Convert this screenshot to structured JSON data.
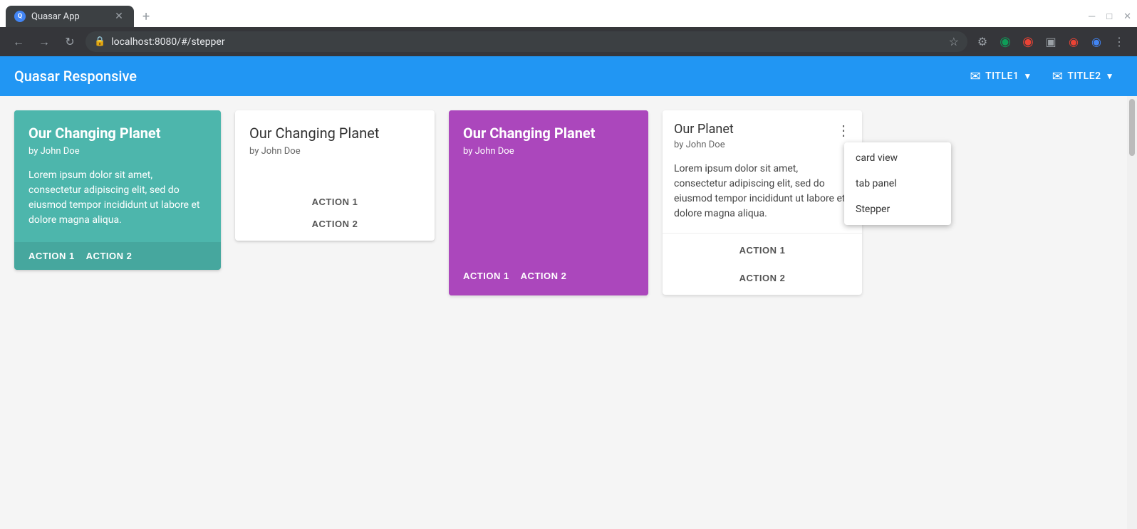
{
  "browser": {
    "tab_title": "Quasar App",
    "url": "localhost:8080/#/stepper",
    "new_tab_icon": "+",
    "back_disabled": false,
    "forward_disabled": true
  },
  "app": {
    "title": "Quasar Responsive",
    "nav_items": [
      {
        "id": "title1",
        "label": "TITLE1",
        "has_arrow": true,
        "icon": "✉"
      },
      {
        "id": "title2",
        "label": "TITLE2",
        "has_arrow": true,
        "icon": "✉"
      }
    ]
  },
  "dropdown": {
    "items": [
      {
        "id": "card-view",
        "label": "card view"
      },
      {
        "id": "tab-panel",
        "label": "tab panel"
      },
      {
        "id": "stepper",
        "label": "Stepper"
      }
    ]
  },
  "cards": [
    {
      "id": "card-green",
      "type": "green",
      "title": "Our Changing Planet",
      "subtitle": "by John Doe",
      "body": "Lorem ipsum dolor sit amet, consectetur adipiscing elit, sed do eiusmod tempor incididunt ut labore et dolore magna aliqua.",
      "actions": [
        "ACTION 1",
        "ACTION 2"
      ]
    },
    {
      "id": "card-white",
      "type": "white",
      "title": "Our Changing Planet",
      "subtitle": "by John Doe",
      "actions": [
        "ACTION 1",
        "ACTION 2"
      ]
    },
    {
      "id": "card-purple",
      "type": "purple",
      "title": "Our Changing Planet",
      "subtitle": "by John Doe",
      "actions": [
        "ACTION 1",
        "ACTION 2"
      ]
    },
    {
      "id": "card-detail",
      "type": "detail",
      "title": "Our Planet",
      "subtitle": "by John Doe",
      "body": "Lorem ipsum dolor sit amet, consectetur adipiscing elit, sed do eiusmod tempor incididunt ut labore et dolore magna aliqua.",
      "actions": [
        "ACTION 1",
        "ACTION 2"
      ]
    }
  ]
}
